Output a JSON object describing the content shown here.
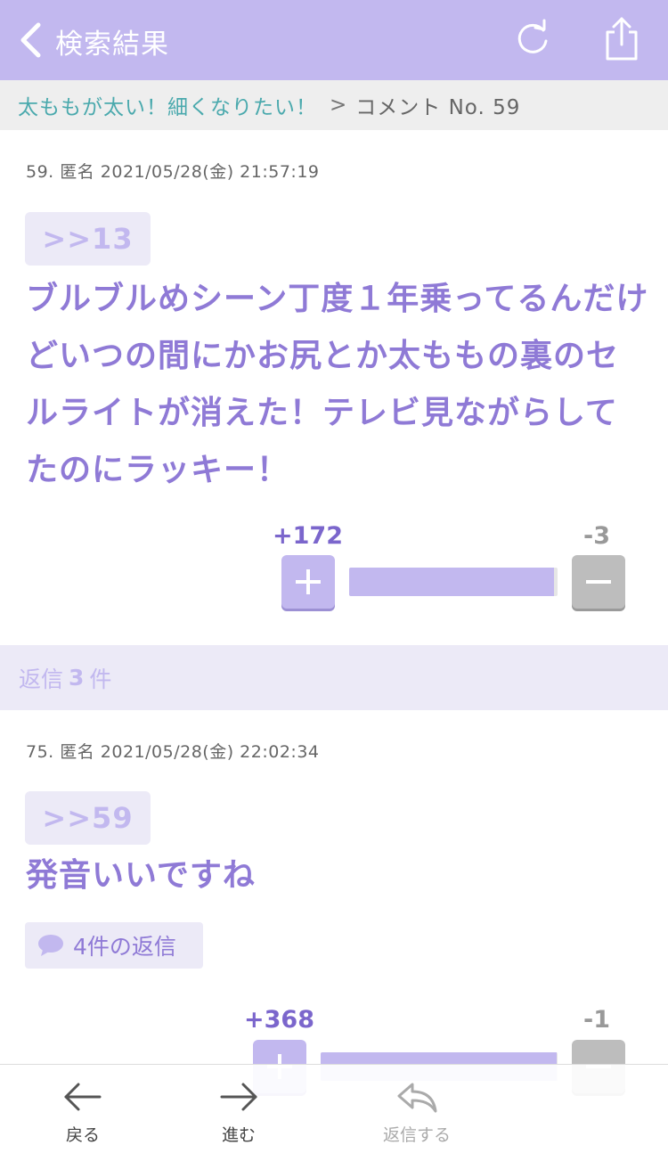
{
  "header": {
    "title": "検索結果",
    "back_icon": "chevron-left-icon",
    "reload_icon": "reload-icon",
    "share_icon": "share-icon"
  },
  "breadcrumb": {
    "link": "太ももが太い！細くなりたい！",
    "separator": ">",
    "current": "コメント No. 59"
  },
  "comment_main": {
    "meta": "59. 匿名 2021/05/28(金) 21:57:19",
    "anchor": ">>13",
    "body": "ブルブルめシーン丁度１年乗ってるんだけどいつの間にかお尻とか太ももの裏のセルライトが消えた！テレビ見ながらしてたのにラッキー！",
    "plus": "+172",
    "minus": "-3",
    "plus_fraction": 0.983
  },
  "replies": {
    "prefix": "返信",
    "count": "3",
    "suffix": "件"
  },
  "comment_reply": {
    "meta": "75. 匿名 2021/05/28(金) 22:02:34",
    "anchor": ">>59",
    "body": "発音いいですね",
    "reply_link": "4件の返信",
    "plus": "+368",
    "minus": "-1",
    "plus_fraction": 0.997
  },
  "toolbar": {
    "back_label": "戻る",
    "forward_label": "進む",
    "reply_label": "返信する"
  },
  "colors": {
    "accent": "#c2b8ef",
    "text_accent": "#8f7ad6",
    "link": "#4aa9ad"
  }
}
